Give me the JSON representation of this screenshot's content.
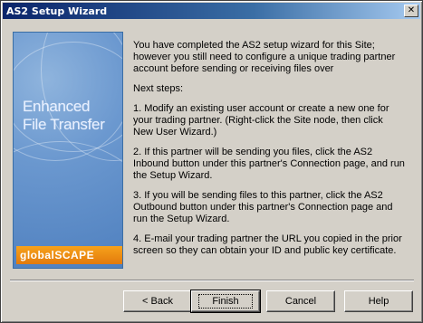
{
  "window": {
    "title": "AS2 Setup Wizard",
    "close_glyph": "✕"
  },
  "banner": {
    "line1": "Enhanced",
    "line2": "File Transfer",
    "logo_text": "globalSCAPE"
  },
  "content": {
    "intro": "You have completed the AS2 setup wizard for this Site; however you still need to configure a unique trading partner account before sending or receiving files over",
    "next_steps": "Next steps:",
    "step1": "1. Modify an existing user account or create a new one for your trading partner. (Right-click the Site node, then click New User Wizard.)",
    "step2": "2. If this partner will be sending you files, click the AS2 Inbound button under this partner's Connection page, and run the Setup Wizard.",
    "step3": "3. If you will be sending files to this partner, click the AS2 Outbound button under this partner's Connection page and run the Setup Wizard.",
    "step4": "4. E-mail your trading partner the URL you copied in the prior screen so they can obtain your ID and public key certificate."
  },
  "buttons": {
    "back": "< Back",
    "finish": "Finish",
    "cancel": "Cancel",
    "help": "Help"
  }
}
